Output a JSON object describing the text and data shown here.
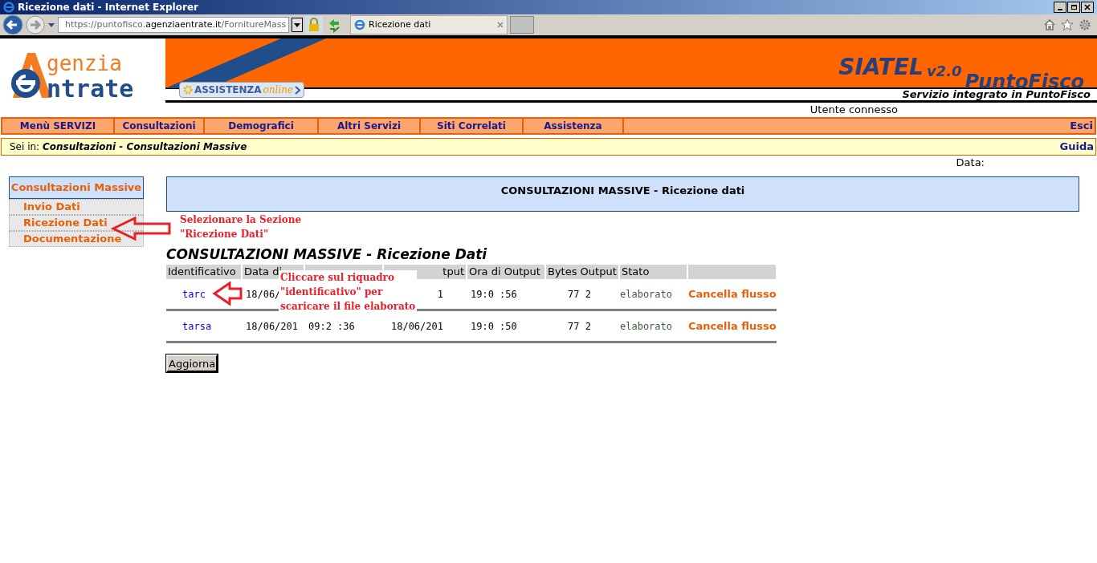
{
  "window": {
    "title": "Ricezione dati - Internet Explorer"
  },
  "browser": {
    "url_host_prefix": "https://puntofisco.",
    "url_host": "agenziaentrate.it",
    "url_path": "/FornitureMass",
    "tab": "Ricezione dati"
  },
  "header": {
    "logo_top": "genzia",
    "logo_bottom": "ntrate",
    "assistenza": "ASSISTENZA",
    "assistenza_suffix": "online",
    "brand": "SIATEL",
    "version": "v2.0",
    "product": "PuntoFisco",
    "subtitle": "Servizio integrato in PuntoFisco",
    "user_label": "Utente connesso"
  },
  "menu": {
    "items": [
      {
        "label": "Menù SERVIZI"
      },
      {
        "label": "Consultazioni"
      },
      {
        "label": "Demografici"
      },
      {
        "label": "Altri Servizi"
      },
      {
        "label": "Siti Correlati"
      },
      {
        "label": "Assistenza"
      }
    ],
    "exit": "Esci"
  },
  "breadcrumb": {
    "prefix": "Sei in:",
    "path": "Consultazioni - Consultazioni Massive",
    "help": "Guida"
  },
  "date_label": "Data:",
  "sidebar": {
    "title": "Consultazioni Massive",
    "items": [
      {
        "label": "Invio Dati"
      },
      {
        "label": "Ricezione Dati"
      },
      {
        "label": "Documentazione"
      }
    ]
  },
  "panel_title": "CONSULTAZIONI MASSIVE - Ricezione dati",
  "section_title": "CONSULTAZIONI MASSIVE - Ricezione Dati",
  "table": {
    "columns": [
      {
        "label": "Identificativo"
      },
      {
        "label": "Data di"
      },
      {},
      {
        "label": "tput"
      },
      {
        "label": "Ora di Output"
      },
      {
        "label": "Bytes Output"
      },
      {
        "label": "Stato"
      },
      {}
    ],
    "rows": [
      {
        "cells": [
          "tarc",
          "18/06/",
          "",
          "1",
          "19:0 :56",
          "77 2",
          "elaborato"
        ],
        "action": "Cancella flusso"
      },
      {
        "cells": [
          "tarsa",
          "18/06/201",
          "09:2 :36",
          "18/06/201",
          "19:0 :50",
          "77 2",
          "elaborato"
        ],
        "action": "Cancella flusso"
      }
    ]
  },
  "refresh_button": "Aggiorna",
  "annotations": [
    {
      "lines": [
        "Selezionare la Sezione",
        "\"Ricezione Dati\""
      ]
    },
    {
      "lines": [
        "Cliccare sul riquadro",
        "\"identificativo\" per",
        "scaricare il file elaborato"
      ]
    }
  ]
}
